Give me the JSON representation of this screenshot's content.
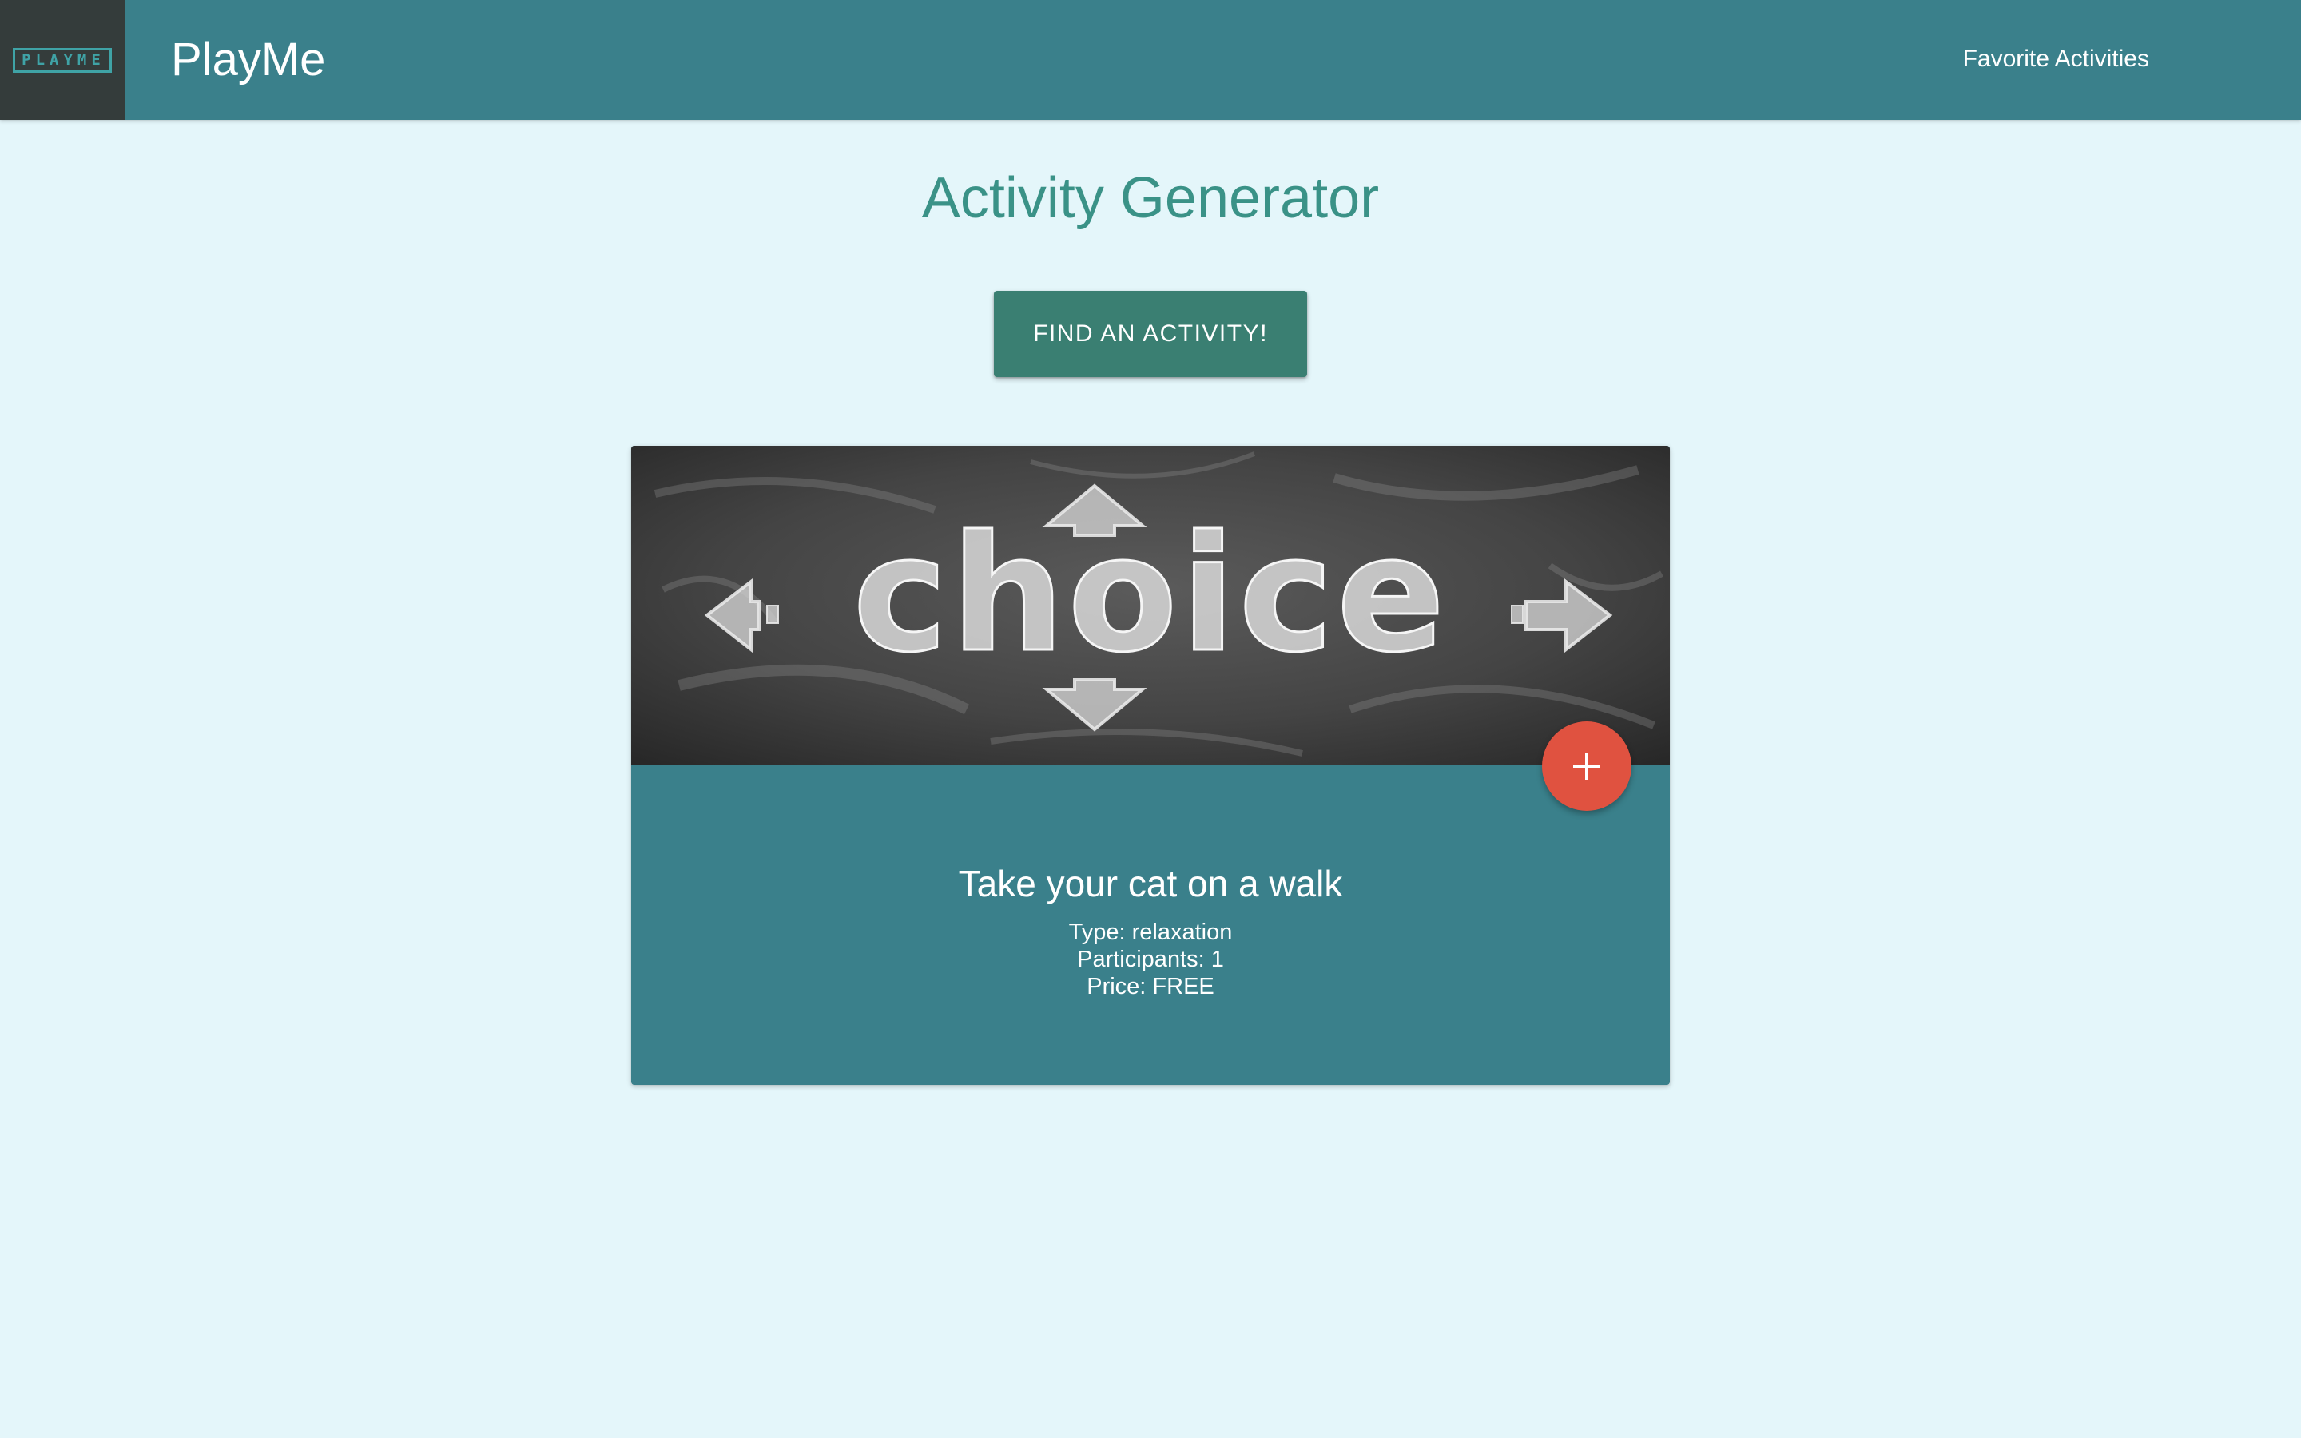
{
  "navbar": {
    "logo_text": "PLAYME",
    "brand": "PlayMe",
    "favorites_link": "Favorite Activities"
  },
  "main": {
    "title": "Activity Generator",
    "find_button": "FIND AN ACTIVITY!"
  },
  "card": {
    "image_text": "choice",
    "activity": "Take your cat on a walk",
    "type_text": "Type: relaxation",
    "participants_text": "Participants: 1",
    "price_text": "Price: FREE",
    "add_icon": "plus-icon"
  },
  "colors": {
    "background": "#e4f6fa",
    "navbar": "#3a808b",
    "logo_box": "#343c3b",
    "accent_text": "#3a9287",
    "button": "#3a7f72",
    "card": "#3a808b",
    "fab": "#e05240"
  }
}
